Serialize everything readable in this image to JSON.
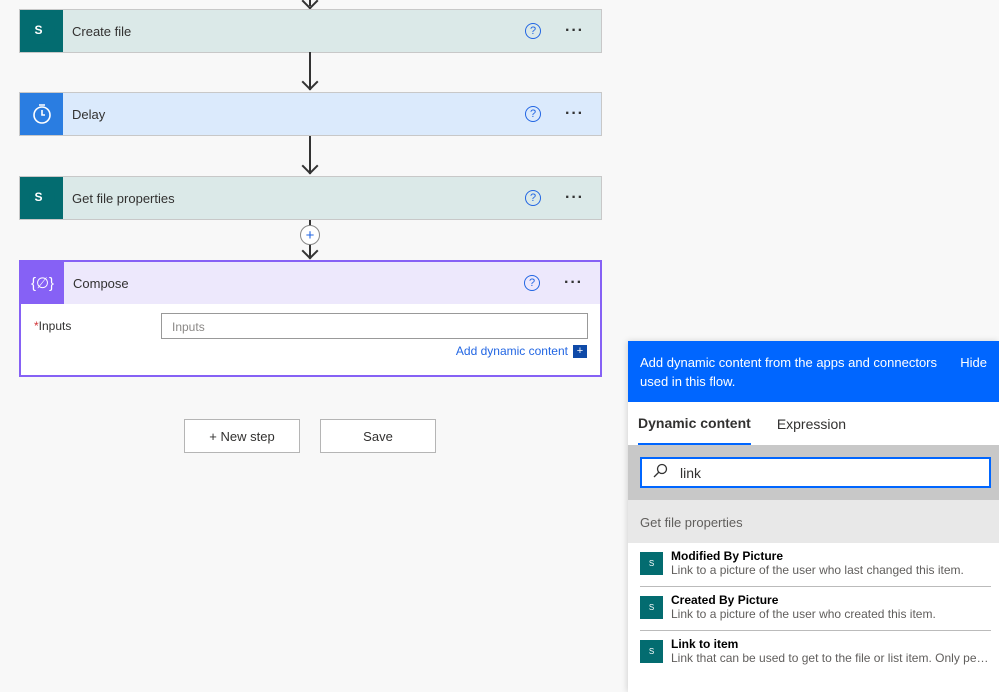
{
  "steps": [
    {
      "title": "Create file",
      "icon": "sharepoint-icon",
      "color": "#dbe9e8",
      "icon_bg": "#036c70"
    },
    {
      "title": "Delay",
      "icon": "timer-icon",
      "color": "#dbeafc",
      "icon_bg": "#2a7de1"
    },
    {
      "title": "Get file properties",
      "icon": "sharepoint-icon",
      "color": "#dbe9e8",
      "icon_bg": "#036c70"
    },
    {
      "title": "Compose",
      "icon": "compose-braces-icon",
      "color": "#ede8fc",
      "icon_bg": "#8661f5"
    }
  ],
  "compose": {
    "required_mark": "*",
    "inputs_label": "Inputs",
    "inputs_placeholder": "Inputs",
    "add_dynamic": "Add dynamic content"
  },
  "buttons": {
    "new_step": "+ New step",
    "save": "Save"
  },
  "panel": {
    "header": "Add dynamic content from the apps and connectors used in this flow.",
    "hide": "Hide",
    "tabs": [
      "Dynamic content",
      "Expression"
    ],
    "search_value": "link",
    "section": "Get file properties",
    "items": [
      {
        "name": "Modified By Picture",
        "desc": "Link to a picture of the user who last changed this item."
      },
      {
        "name": "Created By Picture",
        "desc": "Link to a picture of the user who created this item."
      },
      {
        "name": "Link to item",
        "desc": "Link that can be used to get to the file or list item. Only peo..."
      }
    ]
  }
}
